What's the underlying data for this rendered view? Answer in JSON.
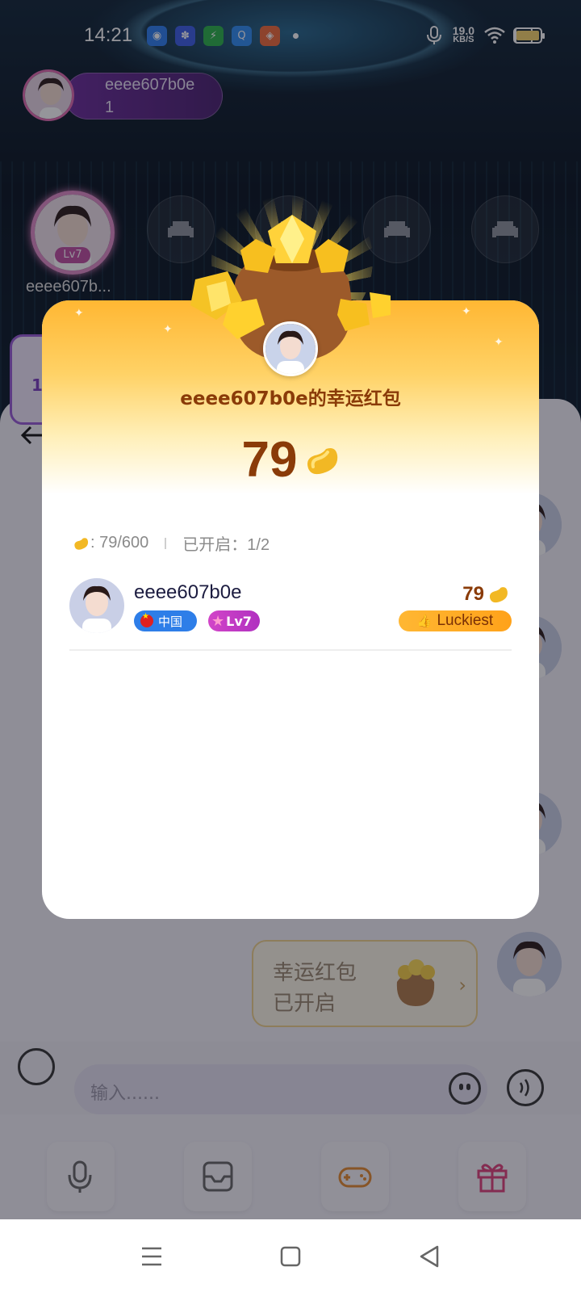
{
  "status_bar": {
    "time": "14:21",
    "speed_value": "19.0",
    "speed_unit": "KB/S",
    "notification_icons": [
      "app-blue-circle-icon",
      "baidu-icon",
      "shield-green-icon",
      "search-blue-icon",
      "game-orange-icon"
    ]
  },
  "room": {
    "owner_name": "eeee607b0e",
    "owner_count": "1",
    "host_seat_level": "Lv7",
    "host_seat_name": "eeee607b...",
    "side_card_value": "1"
  },
  "modal": {
    "title": "eeee607b0e的幸运红包",
    "amount": "79",
    "stats_total": ": 79/600",
    "stats_opened": "已开启：1/2",
    "claims": [
      {
        "name": "eeee607b0e",
        "country": "中国",
        "level": "Lv7",
        "amount": "79",
        "badge": "Luckiest"
      }
    ]
  },
  "chat": {
    "lucky_card_title_line1": "幸运红包",
    "lucky_card_title_line2": "已开启",
    "input_placeholder": "输入......"
  },
  "colors": {
    "accent_brown": "#8a3b08",
    "gold": "#ffb733",
    "level_purple": "#c040c0",
    "country_blue": "#2e7ee8"
  }
}
